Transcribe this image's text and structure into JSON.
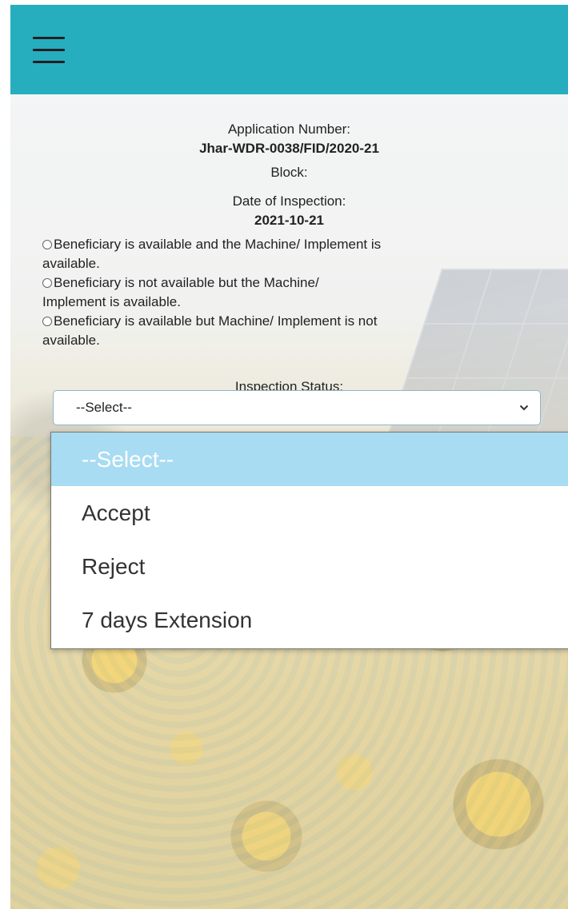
{
  "menu": {
    "icon": "hamburger-menu-icon"
  },
  "application": {
    "number_label": "Application Number:",
    "number_value": "Jhar-WDR-0038/FID/2020-21",
    "block_label": "Block:",
    "date_label": "Date of Inspection:",
    "date_value": "2021-10-21"
  },
  "availability_options": [
    {
      "line1": "Beneficiary is available and the Machine/ Implement is",
      "line2": "available."
    },
    {
      "line1": "Beneficiary is not available but the Machine/",
      "line2": "Implement is available."
    },
    {
      "line1": "Beneficiary is available but Machine/ Implement is not",
      "line2": "available."
    }
  ],
  "inspection": {
    "status_label": "Inspection Status:",
    "selected_value": "--Select--",
    "options": [
      "--Select--",
      "Accept",
      "Reject",
      "7 days Extension"
    ],
    "highlight_color": "#a8dcf2"
  },
  "colors": {
    "header": "#26aebf"
  }
}
